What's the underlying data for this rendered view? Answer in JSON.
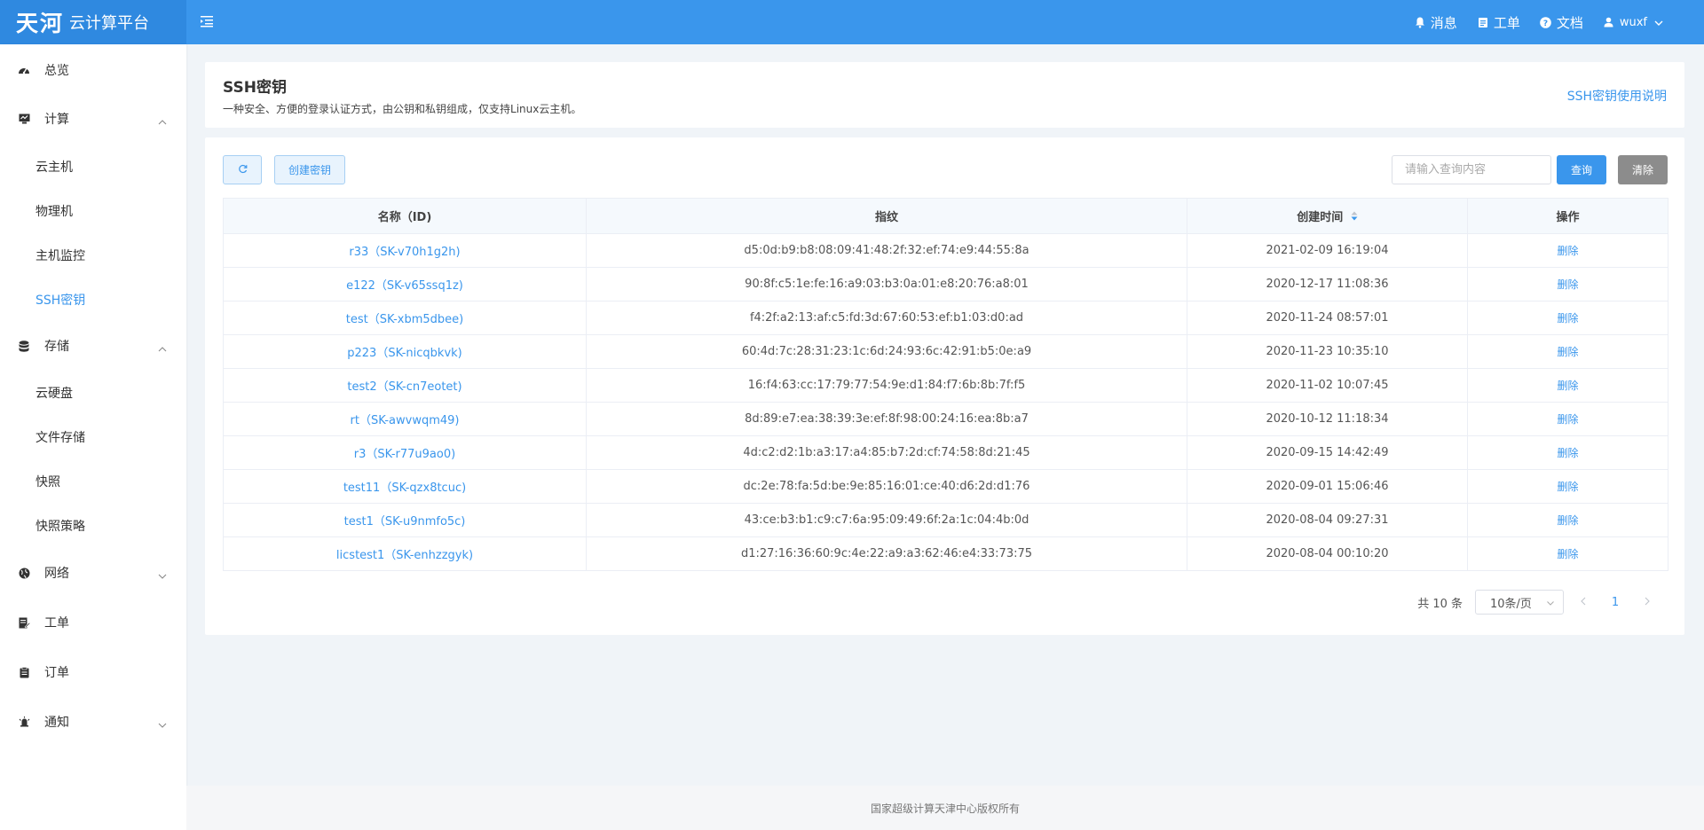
{
  "header": {
    "logo_mark": "天河",
    "logo_text": "云计算平台",
    "links": [
      {
        "label": "消息",
        "icon": "bell-icon"
      },
      {
        "label": "工单",
        "icon": "ticket-icon"
      },
      {
        "label": "文档",
        "icon": "help-icon"
      }
    ],
    "user": "wuxf"
  },
  "sidebar": {
    "overview": "总览",
    "compute": "计算",
    "compute_items": [
      "云主机",
      "物理机",
      "主机监控",
      "SSH密钥"
    ],
    "storage": "存储",
    "storage_items": [
      "云硬盘",
      "文件存储",
      "快照",
      "快照策略"
    ],
    "network": "网络",
    "ticket": "工单",
    "order": "订单",
    "notify": "通知",
    "active_item": "SSH密钥"
  },
  "page": {
    "title": "SSH密钥",
    "description": "一种安全、方便的登录认证方式，由公钥和私钥组成，仅支持Linux云主机。",
    "help_link": "SSH密钥使用说明"
  },
  "toolbar": {
    "create_label": "创建密钥",
    "search_placeholder": "请输入查询内容",
    "query_label": "查询",
    "clear_label": "清除"
  },
  "table": {
    "headers": {
      "name": "名称（ID)",
      "fingerprint": "指纹",
      "created": "创建时间",
      "actions": "操作"
    },
    "rows": [
      {
        "name": "r33（SK-v70h1g2h)",
        "fingerprint": "d5:0d:b9:b8:08:09:41:48:2f:32:ef:74:e9:44:55:8a",
        "created": "2021-02-09 16:19:04",
        "action": "删除"
      },
      {
        "name": "e122（SK-v65ssq1z)",
        "fingerprint": "90:8f:c5:1e:fe:16:a9:03:b3:0a:01:e8:20:76:a8:01",
        "created": "2020-12-17 11:08:36",
        "action": "删除"
      },
      {
        "name": "test（SK-xbm5dbee)",
        "fingerprint": "f4:2f:a2:13:af:c5:fd:3d:67:60:53:ef:b1:03:d0:ad",
        "created": "2020-11-24 08:57:01",
        "action": "删除"
      },
      {
        "name": "p223（SK-nicqbkvk)",
        "fingerprint": "60:4d:7c:28:31:23:1c:6d:24:93:6c:42:91:b5:0e:a9",
        "created": "2020-11-23 10:35:10",
        "action": "删除"
      },
      {
        "name": "test2（SK-cn7eotet)",
        "fingerprint": "16:f4:63:cc:17:79:77:54:9e:d1:84:f7:6b:8b:7f:f5",
        "created": "2020-11-02 10:07:45",
        "action": "删除"
      },
      {
        "name": "rt（SK-awvwqm49)",
        "fingerprint": "8d:89:e7:ea:38:39:3e:ef:8f:98:00:24:16:ea:8b:a7",
        "created": "2020-10-12 11:18:34",
        "action": "删除"
      },
      {
        "name": "r3（SK-r77u9ao0)",
        "fingerprint": "4d:c2:d2:1b:a3:17:a4:85:b7:2d:cf:74:58:8d:21:45",
        "created": "2020-09-15 14:42:49",
        "action": "删除"
      },
      {
        "name": "test11（SK-qzx8tcuc)",
        "fingerprint": "dc:2e:78:fa:5d:be:9e:85:16:01:ce:40:d6:2d:d1:76",
        "created": "2020-09-01 15:06:46",
        "action": "删除"
      },
      {
        "name": "test1（SK-u9nmfo5c)",
        "fingerprint": "43:ce:b3:b1:c9:c7:6a:95:09:49:6f:2a:1c:04:4b:0d",
        "created": "2020-08-04 09:27:31",
        "action": "删除"
      },
      {
        "name": "licstest1（SK-enhzzgyk)",
        "fingerprint": "d1:27:16:36:60:9c:4e:22:a9:a3:62:46:e4:33:73:75",
        "created": "2020-08-04 00:10:20",
        "action": "删除"
      }
    ]
  },
  "pagination": {
    "total": "共 10 条",
    "page_size": "10条/页",
    "current_page": "1"
  },
  "footer": "国家超级计算天津中心版权所有",
  "colors": {
    "primary": "#3a96ec",
    "logo_bg": "#2f89e0",
    "page_bg": "#f0f4f8"
  }
}
